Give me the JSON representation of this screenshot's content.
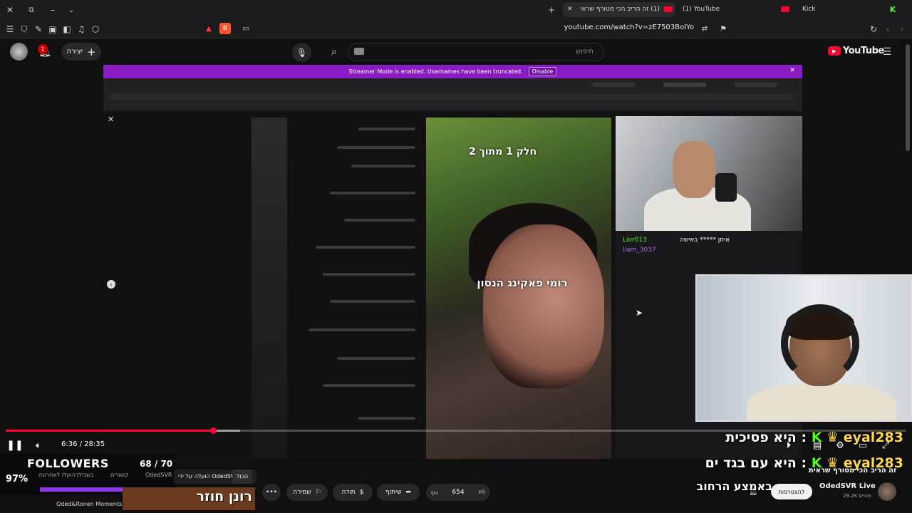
{
  "browser": {
    "tabs": [
      {
        "label": "(1) זה הריב הכי מטורף שראי",
        "active": true
      },
      {
        "label": "(1) YouTube",
        "active": false
      },
      {
        "label": "Kick",
        "active": false
      }
    ],
    "url": "youtube.com/watch?v=zE7503BoIYo"
  },
  "header": {
    "create_label": "יצירה",
    "notification_count": "1",
    "search_placeholder": "חיפוש",
    "logo_text": "YouTube"
  },
  "player": {
    "banner_text": "Streamer Mode is enabled. Usernames have been truncated.",
    "banner_button": "Disable",
    "video_caption_top": "חלק 1 מתוך 2",
    "video_caption_mid": "רומי פאקינג הנסון",
    "stream_chat": [
      {
        "user": "Lior013",
        "msg": "איתן ***** באישה"
      },
      {
        "user": "liam_3037",
        "msg": ""
      }
    ],
    "overlay_chat": [
      {
        "user": "eyal283",
        "msg": "היא פסיכית"
      },
      {
        "user": "eyal283",
        "msg": "היא עם בגד ים"
      },
      {
        "user": "",
        "msg": "באמצע הרחוב"
      }
    ],
    "time_current": "6:36",
    "time_total": "28:35",
    "time_display": "6:36 / 28:35",
    "progress_fraction": 0.23,
    "buffer_fraction": 0.26
  },
  "followers_overlay": {
    "title": "FOLLOWERS",
    "count": "68 / 70",
    "percent_text": "97%",
    "fraction": 0.97
  },
  "below": {
    "chips": [
      "הכול",
      "הועלה על ידי OdedSVR Live"
    ],
    "tabs": [
      "OdedSVR",
      "קשורים",
      "בשבילך",
      "הועלו לאחרונה"
    ],
    "moments_label": "Oded&Ronen Moments",
    "thumb_text": "רונן חוזר",
    "video_title": "זה הריב הכי מטורף שראית",
    "likes": "654",
    "share_label": "שיתוף",
    "thanks_label": "תודה",
    "save_label": "שמירה",
    "subscribe_label": "להצטרפות",
    "channel_name": "OdedSVR Live",
    "subscribers": "29.2K מנויים"
  },
  "colors": {
    "youtube_red": "#ff0033",
    "streamer_banner": "#8a1cc4",
    "kick_green": "#53fc18",
    "follower_bar": "#8b39e8"
  },
  "icons": [
    "close-icon",
    "menu-icon",
    "shield-icon",
    "reload-icon",
    "bookmark-icon",
    "mic-icon",
    "search-icon",
    "bell-icon",
    "play-pause-icon",
    "volume-icon",
    "fullscreen-icon",
    "like-icon",
    "dislike-icon",
    "share-icon",
    "more-icon"
  ]
}
